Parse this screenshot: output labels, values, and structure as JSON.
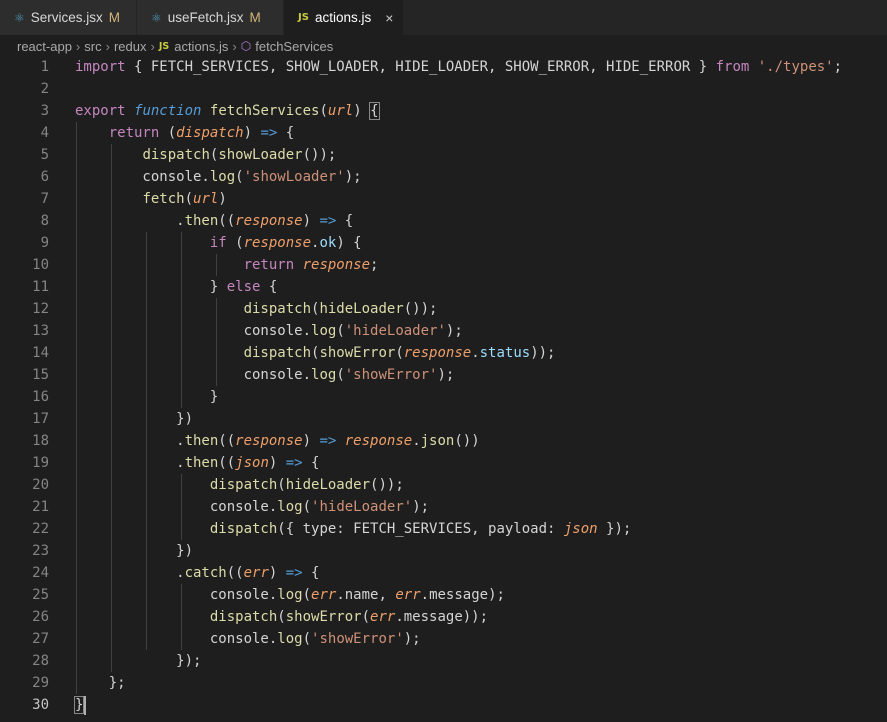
{
  "tabs": [
    {
      "name": "Services.jsx",
      "icon": "react-icon",
      "status": "M"
    },
    {
      "name": "useFetch.jsx",
      "icon": "react-icon",
      "status": "M"
    },
    {
      "name": "actions.js",
      "icon": "js-icon",
      "status": "×"
    }
  ],
  "breadcrumb": {
    "items": [
      "react-app",
      "src",
      "redux",
      "actions.js",
      "fetchServices"
    ],
    "js_badge": "JS"
  },
  "editor": {
    "line_numbers": [
      "1",
      "2",
      "3",
      "4",
      "5",
      "6",
      "7",
      "8",
      "9",
      "10",
      "11",
      "12",
      "13",
      "14",
      "15",
      "16",
      "17",
      "18",
      "19",
      "20",
      "21",
      "22",
      "23",
      "24",
      "25",
      "26",
      "27",
      "28",
      "29",
      "30"
    ],
    "current_line": 30
  },
  "colors": {
    "background": "#1e1e1e",
    "keyword": "#c586c0",
    "storage": "#569cd6",
    "function": "#dcdcaa",
    "parameter": "#ef9f69",
    "property": "#9cdcfe",
    "string": "#ce9178"
  }
}
